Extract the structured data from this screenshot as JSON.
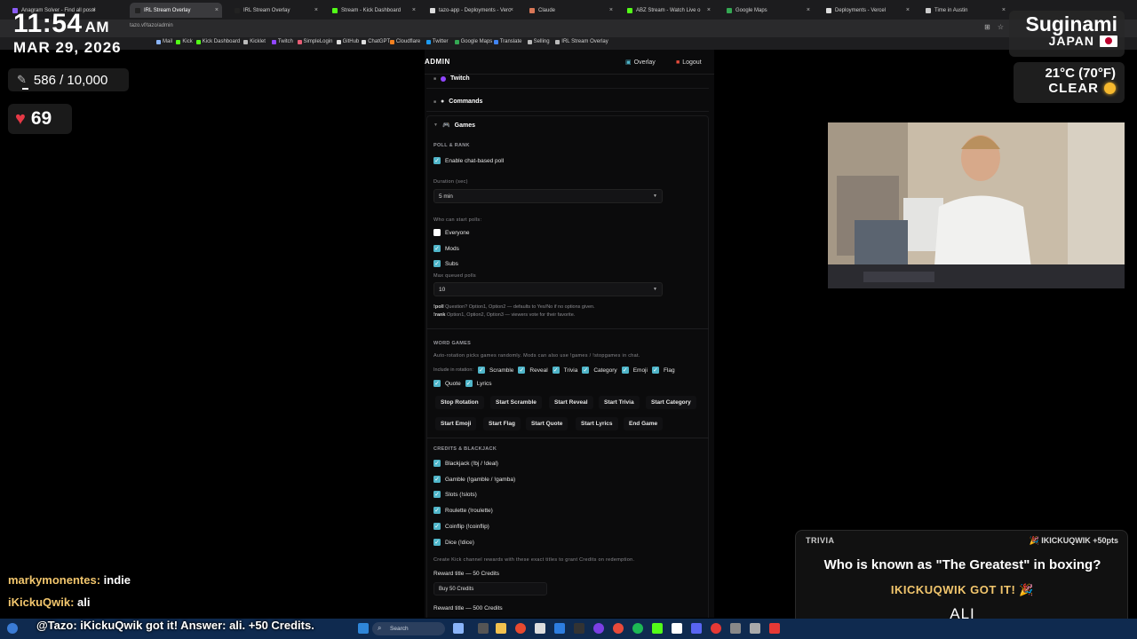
{
  "browser": {
    "tabs": [
      {
        "label": "Anagram Solver - Find all possi",
        "color": "#8b5cf6",
        "active": false
      },
      {
        "label": "IRL Stream Overlay",
        "color": "#222",
        "active": true
      },
      {
        "label": "IRL Stream Overlay",
        "color": "#222",
        "active": false
      },
      {
        "label": "Stream - Kick Dashboard",
        "color": "#53fc18",
        "active": false
      },
      {
        "label": "tazo-app - Deployments - Verc",
        "color": "#ddd",
        "active": false
      },
      {
        "label": "Claude",
        "color": "#d97757",
        "active": false
      },
      {
        "label": "ABZ Stream - Watch Live o",
        "color": "#53fc18",
        "active": false
      },
      {
        "label": "Google Maps",
        "color": "#34a853",
        "active": false
      },
      {
        "label": "Deployments - Vercel",
        "color": "#ddd",
        "active": false
      },
      {
        "label": "Time in Austin",
        "color": "#ccc",
        "active": false
      }
    ],
    "address": "tazo.vf/tazo/admin",
    "bookmarks": [
      {
        "label": "Mail",
        "color": "#8ab4f8"
      },
      {
        "label": "Kick",
        "color": "#53fc18"
      },
      {
        "label": "Kick Dashboard",
        "color": "#53fc18"
      },
      {
        "label": "Kicklet",
        "color": "#bbb"
      },
      {
        "label": "Twitch",
        "color": "#9146ff"
      },
      {
        "label": "SimpleLogin",
        "color": "#e85d75"
      },
      {
        "label": "GitHub",
        "color": "#ddd"
      },
      {
        "label": "ChatGPT",
        "color": "#ddd"
      },
      {
        "label": "Cloudflare",
        "color": "#f38020"
      },
      {
        "label": "Twitter",
        "color": "#1d9bf0"
      },
      {
        "label": "Google Maps",
        "color": "#34a853"
      },
      {
        "label": "Translate",
        "color": "#4285f4"
      },
      {
        "label": "Selling",
        "color": "#bbb"
      },
      {
        "label": "IRL Stream Overlay",
        "color": "#bbb"
      }
    ]
  },
  "overlay": {
    "time": "11:54",
    "ampm": "AM",
    "date": "MAR 29, 2026",
    "distance": "586 / 10,000",
    "distance_progress": 0.0586,
    "hearts": "69",
    "city": "Suginami",
    "country": "JAPAN",
    "temp": "21°C (70°F)",
    "condition": "CLEAR"
  },
  "chat": [
    {
      "user": "markymonentes:",
      "msg": "indie"
    },
    {
      "user": "iKickuQwik:",
      "msg": "ali"
    }
  ],
  "bottom_chat": "@Tazo: iKickuQwik got it! Answer: ali. +50 Credits.",
  "admin": {
    "title": "ADMIN",
    "overlay_btn": "Overlay",
    "logout_btn": "Logout",
    "sections": {
      "twitch": "Twitch",
      "commands": "Commands",
      "games": "Games"
    },
    "poll": {
      "heading": "POLL & RANK",
      "enable": "Enable chat-based poll",
      "duration_label": "Duration (sec)",
      "duration_value": "5 min",
      "who_label": "Who can start polls:",
      "everyone": "Everyone",
      "mods": "Mods",
      "subs": "Subs",
      "max_label": "Max queued polls",
      "max_value": "10",
      "help1_cmd": "!poll",
      "help1": "Question? Option1, Option2 — defaults to Yes/No if no options given.",
      "help2_cmd": "!rank",
      "help2": "Option1, Option2, Option3 — viewers vote for their favorite."
    },
    "word": {
      "heading": "WORD GAMES",
      "help": "Auto-rotation picks games randomly. Mods can also use !games / !stopgames in chat.",
      "include": "Include in rotation:",
      "opts": [
        "Scramble",
        "Reveal",
        "Trivia",
        "Category",
        "Emoji",
        "Flag",
        "Quote",
        "Lyrics"
      ],
      "buttons": [
        "Stop Rotation",
        "Start Scramble",
        "Start Reveal",
        "Start Trivia",
        "Start Category",
        "Start Emoji",
        "Start Flag",
        "Start Quote",
        "Start Lyrics",
        "End Game"
      ]
    },
    "credits": {
      "heading": "CREDITS & BLACKJACK",
      "games": [
        "Blackjack (!bj / !deal)",
        "Gamble (!gamble / !gamba)",
        "Slots (!slots)",
        "Roulette (!roulette)",
        "Coinflip (!coinflip)",
        "Dice (!dice)"
      ],
      "help": "Create Kick channel rewards with these exact titles to grant Credits on redemption.",
      "reward50_label": "Reward title — 50 Credits",
      "reward50_value": "Buy 50 Credits",
      "reward500_label": "Reward title — 500 Credits"
    }
  },
  "trivia": {
    "tag": "TRIVIA",
    "winner": "IKICKUQWIK +50pts",
    "question": "Who is known as \"The Greatest\" in boxing?",
    "got": "IKICKUQWIK GOT IT! 🎉",
    "answer": "ALI"
  },
  "taskbar": {
    "search": "Search"
  }
}
